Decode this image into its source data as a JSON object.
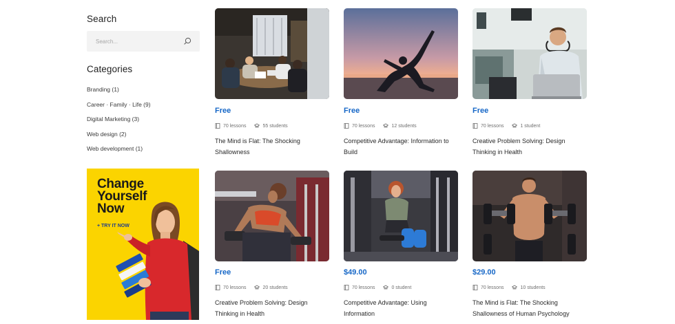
{
  "sidebar": {
    "search_title": "Search",
    "search_placeholder": "Search...",
    "categories_title": "Categories",
    "categories": [
      "Branding (1)",
      "Career · Family · Life (9)",
      "Digital Marketing (3)",
      "Web design (2)",
      "Web development (1)"
    ],
    "promo": {
      "title": "Change\nYourself\nNow",
      "cta": "+ TRY IT NOW",
      "bg_color": "#fbd400"
    }
  },
  "courses": [
    {
      "price": "Free",
      "lessons": "70 lessons",
      "students": "55 students",
      "title": "The Mind is Flat: The Shocking Shallowness"
    },
    {
      "price": "Free",
      "lessons": "70 lessons",
      "students": "12 students",
      "title": "Competitive Advantage: Information to Build"
    },
    {
      "price": "Free",
      "lessons": "70 lessons",
      "students": "1 student",
      "title": "Creative Problem Solving: Design Thinking in Health"
    },
    {
      "price": "Free",
      "lessons": "70 lessons",
      "students": "20 students",
      "title": "Creative Problem Solving: Design Thinking in Health"
    },
    {
      "price": "$49.00",
      "lessons": "70 lessons",
      "students": "0 student",
      "title": "Competitive Advantage: Using Information"
    },
    {
      "price": "$29.00",
      "lessons": "70 lessons",
      "students": "10 students",
      "title": "The Mind is Flat: The Shocking Shallowness of Human Psychology"
    }
  ],
  "colors": {
    "accent": "#1667c7",
    "promo": "#fbd400"
  },
  "icons": {
    "search": "search-icon",
    "lessons": "book-icon",
    "students": "graduation-cap-icon"
  }
}
